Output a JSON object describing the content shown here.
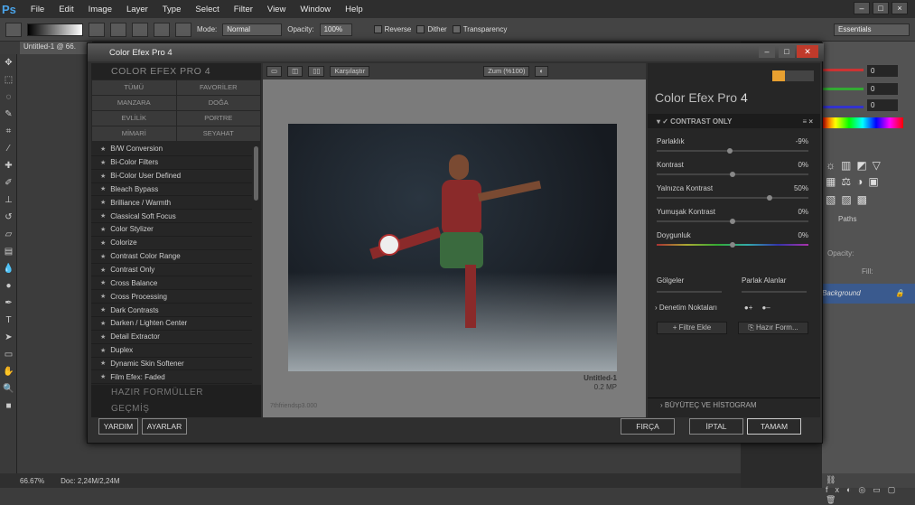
{
  "app": {
    "logo": "Ps",
    "menu": [
      "File",
      "Edit",
      "Image",
      "Layer",
      "Type",
      "Select",
      "Filter",
      "View",
      "Window",
      "Help"
    ],
    "window_controls": [
      "–",
      "□",
      "×"
    ]
  },
  "options": {
    "mode_label": "Mode:",
    "mode_value": "Normal",
    "opacity_label": "Opacity:",
    "opacity_value": "100%",
    "reverse": "Reverse",
    "dither": "Dither",
    "transparency": "Transparency",
    "workspace": "Essentials"
  },
  "document": {
    "tab": "Untitled-1 @ 66.",
    "zoom": "66.67%",
    "doc_size": "Doc: 2,24M/2,24M"
  },
  "right_panel": {
    "values": [
      "0",
      "0",
      "0"
    ],
    "paths": "Paths",
    "opacity": "Opacity:",
    "fill": "Fill:",
    "layer": "Background"
  },
  "dialog": {
    "title": "Color Efex Pro 4",
    "left_title": "COLOR EFEX PRO 4",
    "categories": [
      "TÜMÜ",
      "FAVORİLER",
      "MANZARA",
      "DOĞA",
      "EVLİLİK",
      "PORTRE",
      "MİMARİ",
      "SEYAHAT"
    ],
    "filters": [
      "B/W Conversion",
      "Bi-Color Filters",
      "Bi-Color User Defined",
      "Bleach Bypass",
      "Brilliance / Warmth",
      "Classical Soft Focus",
      "Color Stylizer",
      "Colorize",
      "Contrast Color Range",
      "Contrast Only",
      "Cross Balance",
      "Cross Processing",
      "Dark Contrasts",
      "Darken / Lighten Center",
      "Detail Extractor",
      "Duplex",
      "Dynamic Skin Softener",
      "Film Efex: Faded"
    ],
    "section_presets": "HAZIR FORMÜLLER",
    "section_history": "GEÇMİŞ",
    "preview_compare": "Karşılaştır",
    "preview_zoom": "Zum (%100)",
    "doc_name": "Untitled-1",
    "doc_mp": "0.2 MP",
    "watermark": "7thfriendsp3.000",
    "cep_title": "Color Efex Pro",
    "cep_version": "4",
    "filter_name": "CONTRAST ONLY",
    "sliders": [
      {
        "label": "Parlaklık",
        "value": "-9%",
        "level": 0.48
      },
      {
        "label": "Kontrast",
        "value": "0%",
        "level": 0.5
      },
      {
        "label": "Yalnızca Kontrast",
        "value": "50%",
        "level": 0.75
      },
      {
        "label": "Yumuşak Kontrast",
        "value": "0%",
        "level": 0.5
      },
      {
        "label": "Doygunluk",
        "value": "0%",
        "level": 0.5
      }
    ],
    "shadows": "Gölgeler",
    "highlights": "Parlak Alanlar",
    "control_points": "Denetim Noktaları",
    "add_filter": "Filtre Ekle",
    "save_preset": "Hazır Form...",
    "loupe": "BÜYÜTEÇ VE HİSTOGRAM",
    "help_btn": "YARDIM",
    "settings_btn": "AYARLAR",
    "brush_btn": "FIRÇA",
    "cancel_btn": "İPTAL",
    "ok_btn": "TAMAM"
  }
}
